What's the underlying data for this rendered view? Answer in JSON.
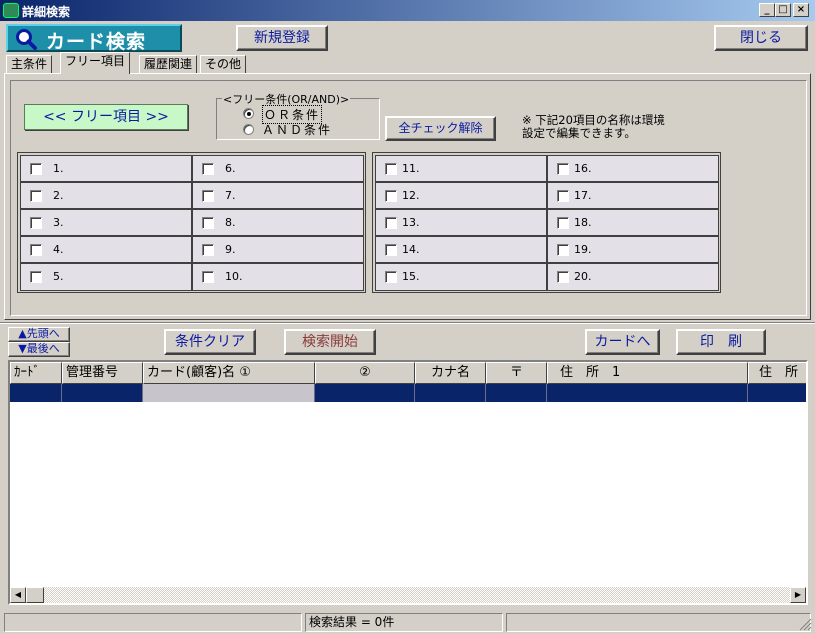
{
  "window": {
    "title": "詳細検索"
  },
  "header": {
    "logo_text": "カード検索",
    "new_register": "新規登録",
    "close": "閉じる"
  },
  "tabs": [
    {
      "label": "主条件"
    },
    {
      "label": "フリー項目"
    },
    {
      "label": "履歴関連"
    },
    {
      "label": "その他"
    }
  ],
  "free": {
    "toggle_button": "<< フリー項目 >>",
    "group_title": "<フリー条件(OR/AND)>",
    "or_label": "ＯＲ条件",
    "and_label": "ＡＮＤ条件",
    "uncheck_all": "全チェック解除",
    "note_line1": "※ 下記20項目の名称は環境",
    "note_line2": "設定で編集できます。",
    "items": [
      "1.",
      "2.",
      "3.",
      "4.",
      "5.",
      "6.",
      "7.",
      "8.",
      "9.",
      "10.",
      "11.",
      "12.",
      "13.",
      "14.",
      "15.",
      "16.",
      "17.",
      "18.",
      "19.",
      "20."
    ]
  },
  "toolbar": {
    "to_top": "▲先頭へ",
    "to_last": "▼最後へ",
    "clear": "条件クリア",
    "search": "検索開始",
    "to_card": "カードへ",
    "print": "印　刷"
  },
  "table": {
    "columns": [
      "ｶｰﾄﾞ",
      "管理番号",
      "カード(顧客)名 ①",
      "②",
      "カナ名",
      "〒",
      "住　所　1",
      "住　所"
    ]
  },
  "status": {
    "result": "検索結果 = 0件"
  },
  "colors": {
    "selection": "#0a246a",
    "logo_bg": "#1e8fa8",
    "free_btn": "#c8f8c8"
  }
}
